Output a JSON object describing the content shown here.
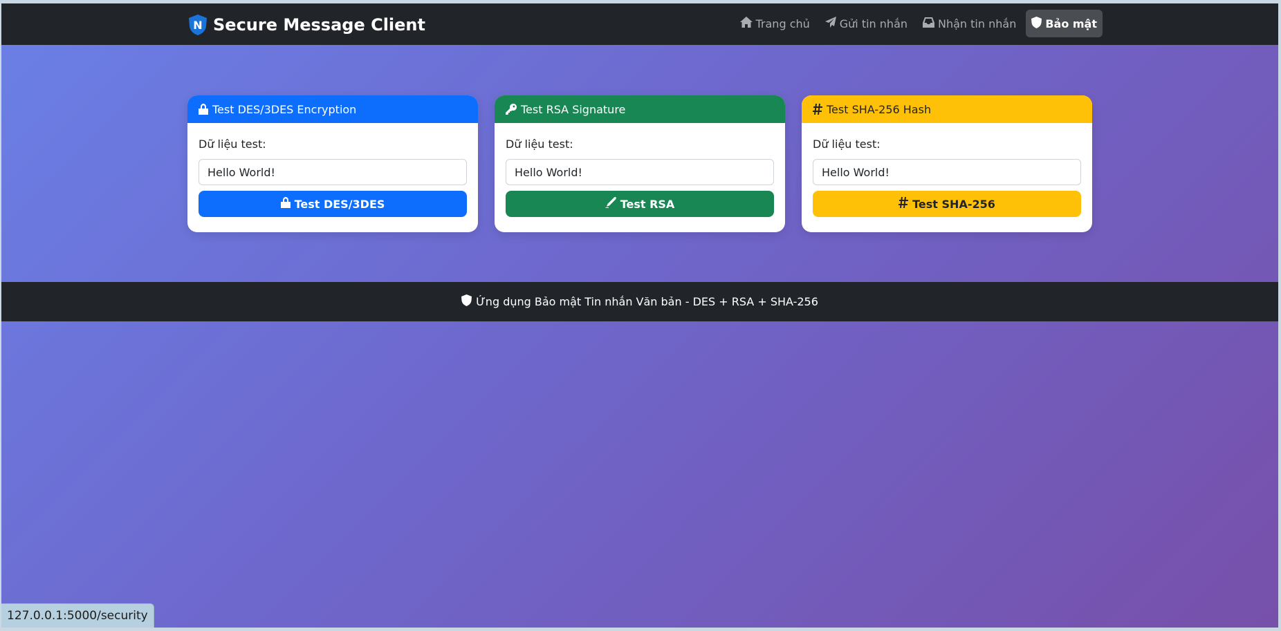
{
  "navbar": {
    "brand": {
      "icon": "shield-n-logo-icon",
      "logo_letter": "N",
      "text": "Secure Message Client"
    },
    "links": [
      {
        "label": "Trang chủ",
        "icon": "home-icon"
      },
      {
        "label": "Gửi tin nhắn",
        "icon": "paper-plane-icon"
      },
      {
        "label": "Nhận tin nhắn",
        "icon": "inbox-icon"
      },
      {
        "label": "Bảo mật",
        "icon": "shield-icon",
        "active": true
      }
    ]
  },
  "cards": [
    {
      "title": "Test DES/3DES Encryption",
      "icon": "lock-icon",
      "color": "#0d6efd",
      "field_label": "Dữ liệu test:",
      "input_value": "Hello World!",
      "button_label": "Test DES/3DES",
      "button_icon": "lock-icon"
    },
    {
      "title": "Test RSA Signature",
      "icon": "key-icon",
      "color": "#198754",
      "field_label": "Dữ liệu test:",
      "input_value": "Hello World!",
      "button_label": "Test RSA",
      "button_icon": "signature-pen-icon"
    },
    {
      "title": "Test SHA-256 Hash",
      "icon": "hashtag-icon",
      "color": "#ffc107",
      "field_label": "Dữ liệu test:",
      "input_value": "Hello World!",
      "button_label": "Test SHA-256",
      "button_icon": "hashtag-icon"
    }
  ],
  "footer": {
    "icon": "shield-icon",
    "text": "Ứng dụng Bảo mật Tin nhắn Văn bản - DES + RSA + SHA-256"
  },
  "statusbar": {
    "url": "127.0.0.1:5000/security"
  },
  "colors": {
    "navbar_bg": "#212529",
    "background_start": "#6a80e6",
    "background_end": "#7750aa"
  }
}
